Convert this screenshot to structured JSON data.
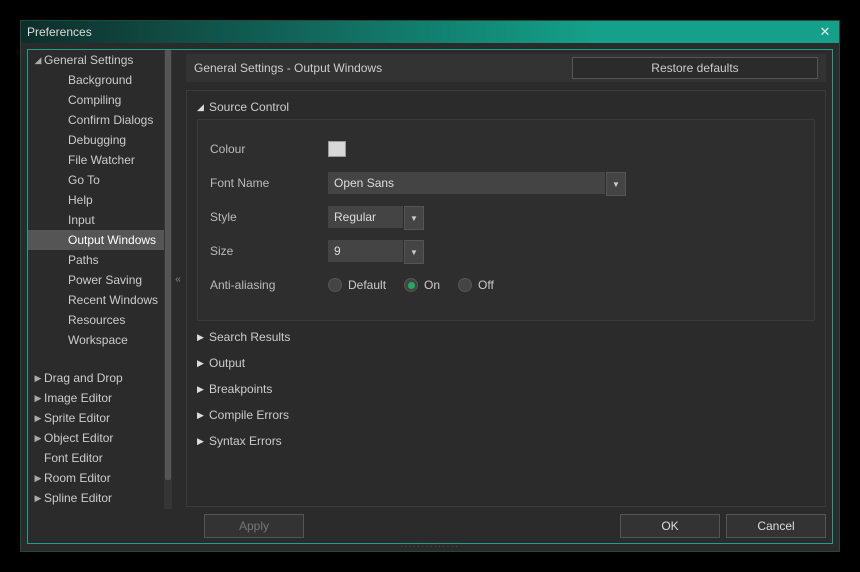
{
  "title": "Preferences",
  "sidebar": {
    "items": [
      {
        "label": "General Settings",
        "depth": 1,
        "arrow": "▼"
      },
      {
        "label": "Background",
        "depth": 2
      },
      {
        "label": "Compiling",
        "depth": 2
      },
      {
        "label": "Confirm Dialogs",
        "depth": 2
      },
      {
        "label": "Debugging",
        "depth": 2
      },
      {
        "label": "File Watcher",
        "depth": 2
      },
      {
        "label": "Go To",
        "depth": 2
      },
      {
        "label": "Help",
        "depth": 2
      },
      {
        "label": "Input",
        "depth": 2
      },
      {
        "label": "Output Windows",
        "depth": 2,
        "selected": true
      },
      {
        "label": "Paths",
        "depth": 2
      },
      {
        "label": "Power Saving",
        "depth": 2
      },
      {
        "label": "Recent Windows",
        "depth": 2
      },
      {
        "label": "Resources",
        "depth": 2
      },
      {
        "label": "Workspace",
        "depth": 2
      },
      {
        "label": "Drag and Drop",
        "depth": 1,
        "arrow": "▶",
        "gap": true
      },
      {
        "label": "Image Editor",
        "depth": 1,
        "arrow": "▶"
      },
      {
        "label": "Sprite Editor",
        "depth": 1,
        "arrow": "▶"
      },
      {
        "label": "Object Editor",
        "depth": 1,
        "arrow": "▶"
      },
      {
        "label": "Font Editor",
        "depth": 1
      },
      {
        "label": "Room Editor",
        "depth": 1,
        "arrow": "▶"
      },
      {
        "label": "Spline Editor",
        "depth": 1,
        "arrow": "▶"
      }
    ]
  },
  "collapse_glyph": "«",
  "header": {
    "breadcrumb": "General Settings - Output Windows",
    "restore_label": "Restore defaults"
  },
  "sections": {
    "source_control": {
      "title": "Source Control",
      "expanded": true,
      "labels": {
        "colour": "Colour",
        "font_name": "Font Name",
        "style": "Style",
        "size": "Size",
        "anti_aliasing": "Anti-aliasing"
      },
      "colour_value": "#d8d8d8",
      "font_name_value": "Open Sans",
      "style_value": "Regular",
      "size_value": "9",
      "aa_options": {
        "default": "Default",
        "on": "On",
        "off": "Off"
      },
      "aa_selected": "on"
    },
    "collapsed": [
      "Search Results",
      "Output",
      "Breakpoints",
      "Compile Errors",
      "Syntax Errors"
    ]
  },
  "footer": {
    "apply": "Apply",
    "ok": "OK",
    "cancel": "Cancel"
  }
}
